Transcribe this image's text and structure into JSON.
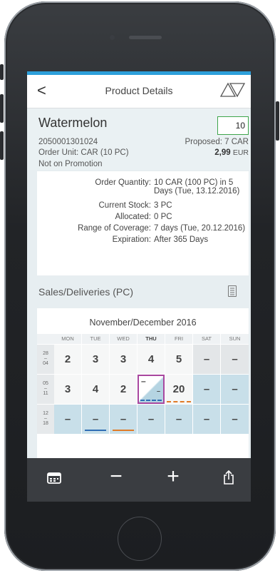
{
  "nav": {
    "back_label": "<",
    "title": "Product Details",
    "prev_icon": "triangle-up-icon",
    "next_icon": "triangle-down-icon"
  },
  "product": {
    "name": "Watermelon",
    "id": "2050001301024",
    "order_unit": "Order Unit: CAR (10 PC)",
    "promotion": "Not on Promotion",
    "quantity": "10",
    "proposed": "Proposed: 7 CAR",
    "price": "2,99",
    "currency": "EUR"
  },
  "info": [
    {
      "label": "Order Quantity:",
      "value": "10 CAR (100 PC) in 5 Days (Tue, 13.12.2016)"
    },
    {
      "label": "Current Stock:",
      "value": "3 PC"
    },
    {
      "label": "Allocated:",
      "value": "0 PC"
    },
    {
      "label": "Range of Coverage:",
      "value": "7 days (Tue, 20.12.2016)"
    },
    {
      "label": "Expiration:",
      "value": "After 365 Days"
    }
  ],
  "sales": {
    "title": "Sales/Deliveries (PC)",
    "icon": "calendar-list-icon"
  },
  "calendar": {
    "title": "November/December 2016",
    "days": [
      "MON",
      "TUE",
      "WED",
      "THU",
      "FRI",
      "SAT",
      "SUN"
    ],
    "weeks": [
      {
        "label_top": "28",
        "label_mid": "–",
        "label_bot": "04",
        "values": [
          "2",
          "3",
          "3",
          "4",
          "5",
          "–",
          "–"
        ]
      },
      {
        "label_top": "05",
        "label_mid": "–",
        "label_bot": "11",
        "values": [
          "3",
          "4",
          "2",
          "–",
          "20",
          "–",
          "–"
        ]
      },
      {
        "label_top": "12",
        "label_mid": "–",
        "label_bot": "18",
        "values": [
          "–",
          "–",
          "–",
          "–",
          "–",
          "–",
          "–"
        ]
      }
    ],
    "selected_small": "–"
  },
  "toolbar": {
    "items": [
      "calendar-icon",
      "minus-icon",
      "plus-icon",
      "share-icon"
    ],
    "minus": "−",
    "plus": "+"
  },
  "colors": {
    "accent": "#2d9fda",
    "input_border": "#3ea54b",
    "selected_border": "#a8479f",
    "delivery_blue": "#2f6db5",
    "delivery_orange": "#e07b28"
  }
}
